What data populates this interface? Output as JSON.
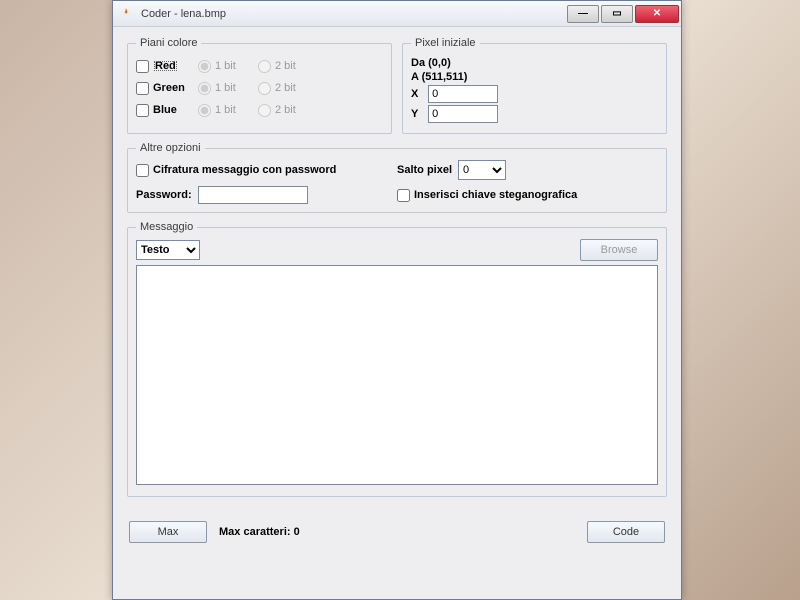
{
  "window": {
    "title": "Coder - lena.bmp"
  },
  "piani": {
    "legend": "Piani colore",
    "rows": [
      {
        "name": "Red",
        "bit1": "1 bit",
        "bit2": "2 bit"
      },
      {
        "name": "Green",
        "bit1": "1 bit",
        "bit2": "2 bit"
      },
      {
        "name": "Blue",
        "bit1": "1 bit",
        "bit2": "2 bit"
      }
    ]
  },
  "pixel": {
    "legend": "Pixel iniziale",
    "da": "Da (0,0)",
    "a": "A (511,511)",
    "x_label": "X",
    "x_value": "0",
    "y_label": "Y",
    "y_value": "0"
  },
  "altre": {
    "legend": "Altre opzioni",
    "cifratura": "Cifratura messaggio con password",
    "password_label": "Password:",
    "password_value": "",
    "salto_label": "Salto pixel",
    "salto_value": "0",
    "inserisci": "Inserisci chiave steganografica"
  },
  "msg": {
    "legend": "Messaggio",
    "type_value": "Testo",
    "browse": "Browse",
    "text": ""
  },
  "bottom": {
    "max_btn": "Max",
    "max_caratteri": "Max caratteri: 0",
    "code_btn": "Code"
  }
}
